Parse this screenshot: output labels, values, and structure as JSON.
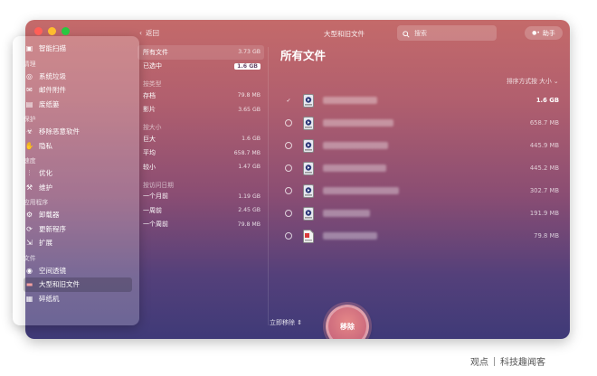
{
  "window": {
    "title": "大型和旧文件",
    "back_label": "返回"
  },
  "search": {
    "placeholder": "搜索"
  },
  "assistant": {
    "label": "助手"
  },
  "sidebar": {
    "top_item": {
      "label": "智能扫描",
      "icon": "smart-scan-icon"
    },
    "sections": [
      {
        "title": "清理",
        "items": [
          {
            "label": "系统垃圾",
            "icon": "system-junk-icon"
          },
          {
            "label": "邮件附件",
            "icon": "mail-icon"
          },
          {
            "label": "废纸篓",
            "icon": "trash-icon"
          }
        ]
      },
      {
        "title": "保护",
        "items": [
          {
            "label": "移除恶意软件",
            "icon": "biohazard-icon"
          },
          {
            "label": "隐私",
            "icon": "hand-icon"
          }
        ]
      },
      {
        "title": "速度",
        "items": [
          {
            "label": "优化",
            "icon": "sliders-icon"
          },
          {
            "label": "维护",
            "icon": "wrench-icon"
          }
        ]
      },
      {
        "title": "应用程序",
        "items": [
          {
            "label": "卸载器",
            "icon": "uninstaller-icon"
          },
          {
            "label": "更新程序",
            "icon": "updater-icon"
          },
          {
            "label": "扩展",
            "icon": "extensions-icon"
          }
        ]
      },
      {
        "title": "文件",
        "items": [
          {
            "label": "空间透镜",
            "icon": "lens-icon"
          },
          {
            "label": "大型和旧文件",
            "icon": "folder-icon",
            "active": true
          },
          {
            "label": "碎纸机",
            "icon": "shredder-icon"
          }
        ]
      }
    ]
  },
  "filters": {
    "all_files": {
      "label": "所有文件",
      "value": "3.73 GB"
    },
    "selected": {
      "label": "已选中",
      "value": "1.6 GB"
    },
    "by_type": {
      "title": "按类型",
      "items": [
        {
          "label": "存档",
          "value": "79.8 MB"
        },
        {
          "label": "影片",
          "value": "3.65 GB"
        }
      ]
    },
    "by_size": {
      "title": "按大小",
      "items": [
        {
          "label": "巨大",
          "value": "1.6 GB"
        },
        {
          "label": "平均",
          "value": "658.7 MB"
        },
        {
          "label": "较小",
          "value": "1.47 GB"
        }
      ]
    },
    "by_access": {
      "title": "按访问日期",
      "items": [
        {
          "label": "一个月前",
          "value": "1.19 GB"
        },
        {
          "label": "一周前",
          "value": "2.45 GB"
        },
        {
          "label": "一个周前",
          "value": "79.8 MB"
        }
      ]
    }
  },
  "main": {
    "title": "所有文件",
    "sort_label": "排序方式按 大小 ⌄",
    "files": [
      {
        "size": "1.6 GB",
        "checked": true,
        "type": "video"
      },
      {
        "size": "658.7 MB",
        "checked": false,
        "type": "video"
      },
      {
        "size": "445.9 MB",
        "checked": false,
        "type": "video"
      },
      {
        "size": "445.2 MB",
        "checked": false,
        "type": "video"
      },
      {
        "size": "302.7 MB",
        "checked": false,
        "type": "video"
      },
      {
        "size": "191.9 MB",
        "checked": false,
        "type": "video"
      },
      {
        "size": "79.8 MB",
        "checked": false,
        "type": "archive"
      }
    ]
  },
  "bottom": {
    "remove_mode": "立即移除 ⇕",
    "remove_button": "移除"
  },
  "watermark": {
    "left": "观点",
    "right": "科技趣闻客"
  },
  "colors": {
    "close": "#ff5f57",
    "minimize": "#febc2e",
    "zoom": "#28c840",
    "accent": "#cc6a7d"
  }
}
